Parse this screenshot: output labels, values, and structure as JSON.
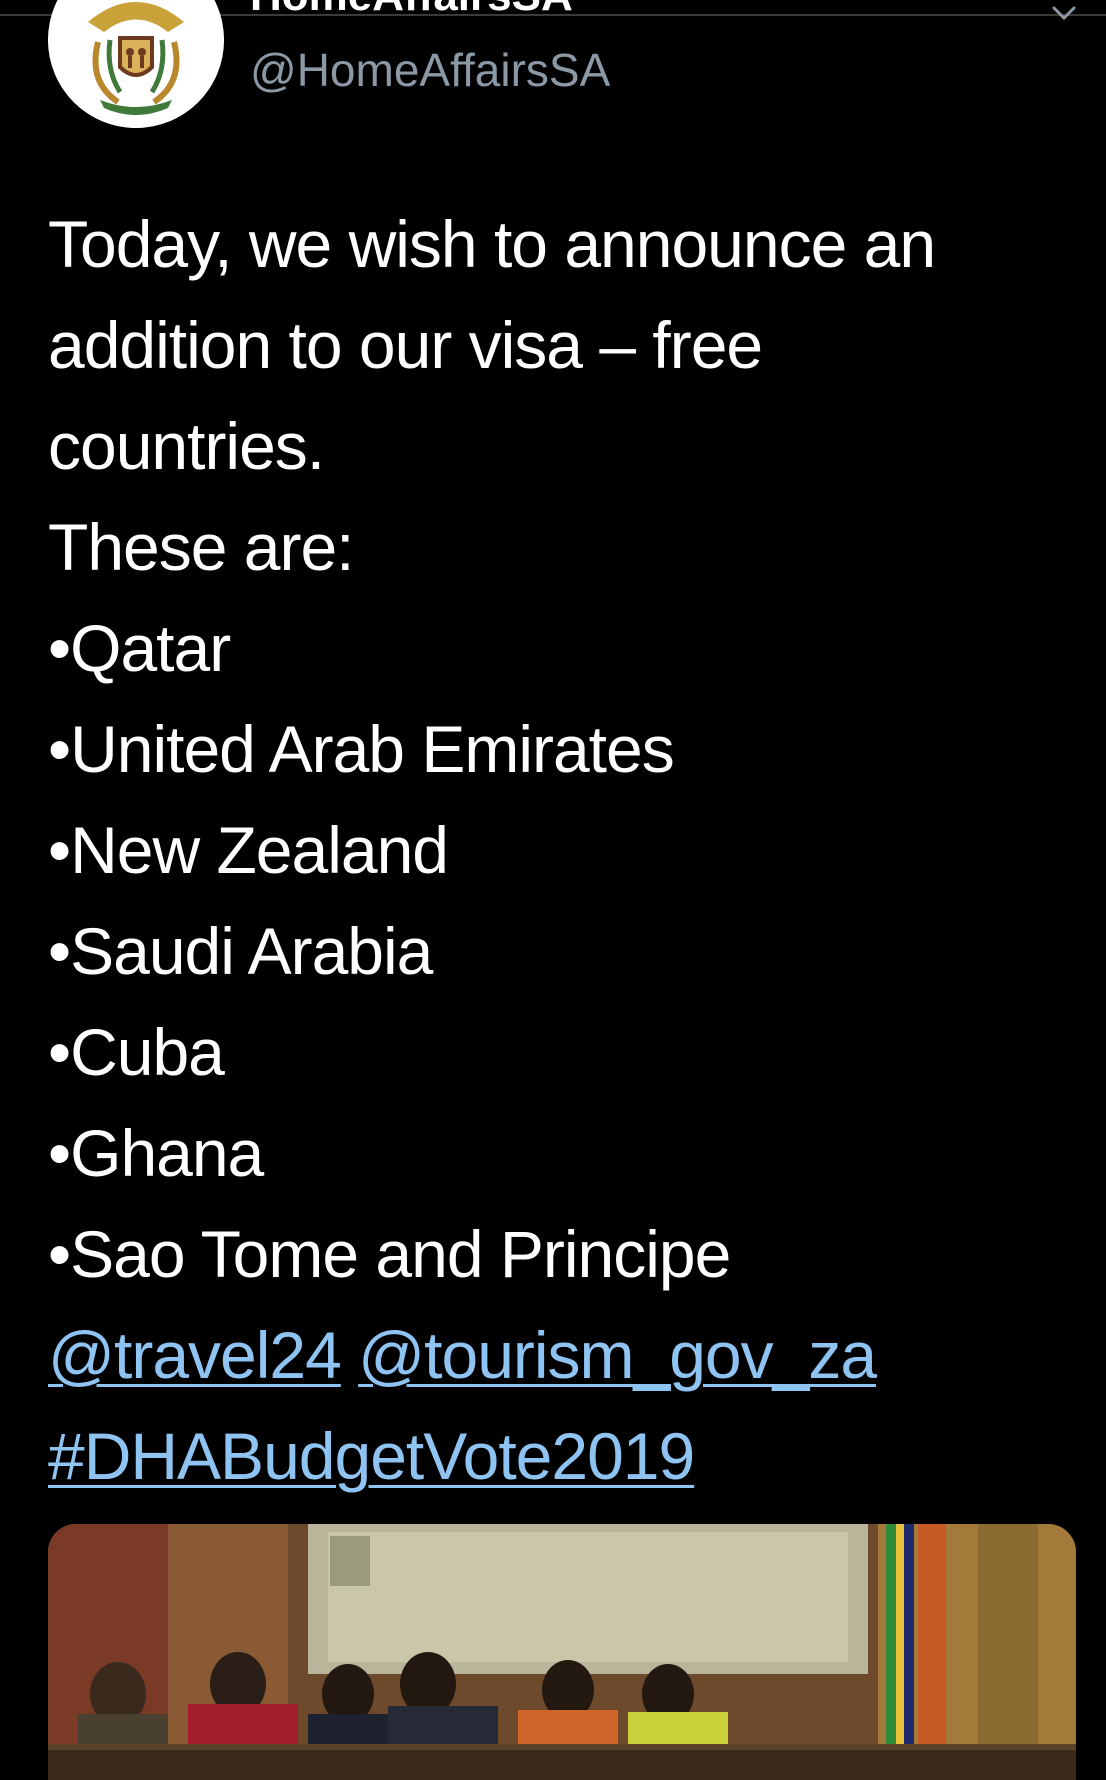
{
  "account": {
    "display_name": "HomeAffairsSA",
    "handle": "@HomeAffairsSA",
    "avatar_icon": "coat-of-arms-icon"
  },
  "tweet": {
    "lines": [
      "Today, we wish to announce an",
      "addition to our visa – free",
      "countries.",
      "These are:"
    ],
    "bullets": [
      "•Qatar",
      "•United Arab Emirates",
      "•New Zealand",
      "•Saudi Arabia",
      "•Cuba",
      "•Ghana",
      "•Sao Tome and Principe"
    ],
    "mentions": [
      "@travel24",
      "@tourism_gov_za"
    ],
    "hashtag": "#DHABudgetVote2019"
  },
  "media": {
    "type": "photo",
    "icon": "photo-parliament-icon"
  },
  "colors": {
    "background": "#000000",
    "text": "#ffffff",
    "secondary_text": "#8b98a5",
    "link": "#8ec3f2"
  }
}
